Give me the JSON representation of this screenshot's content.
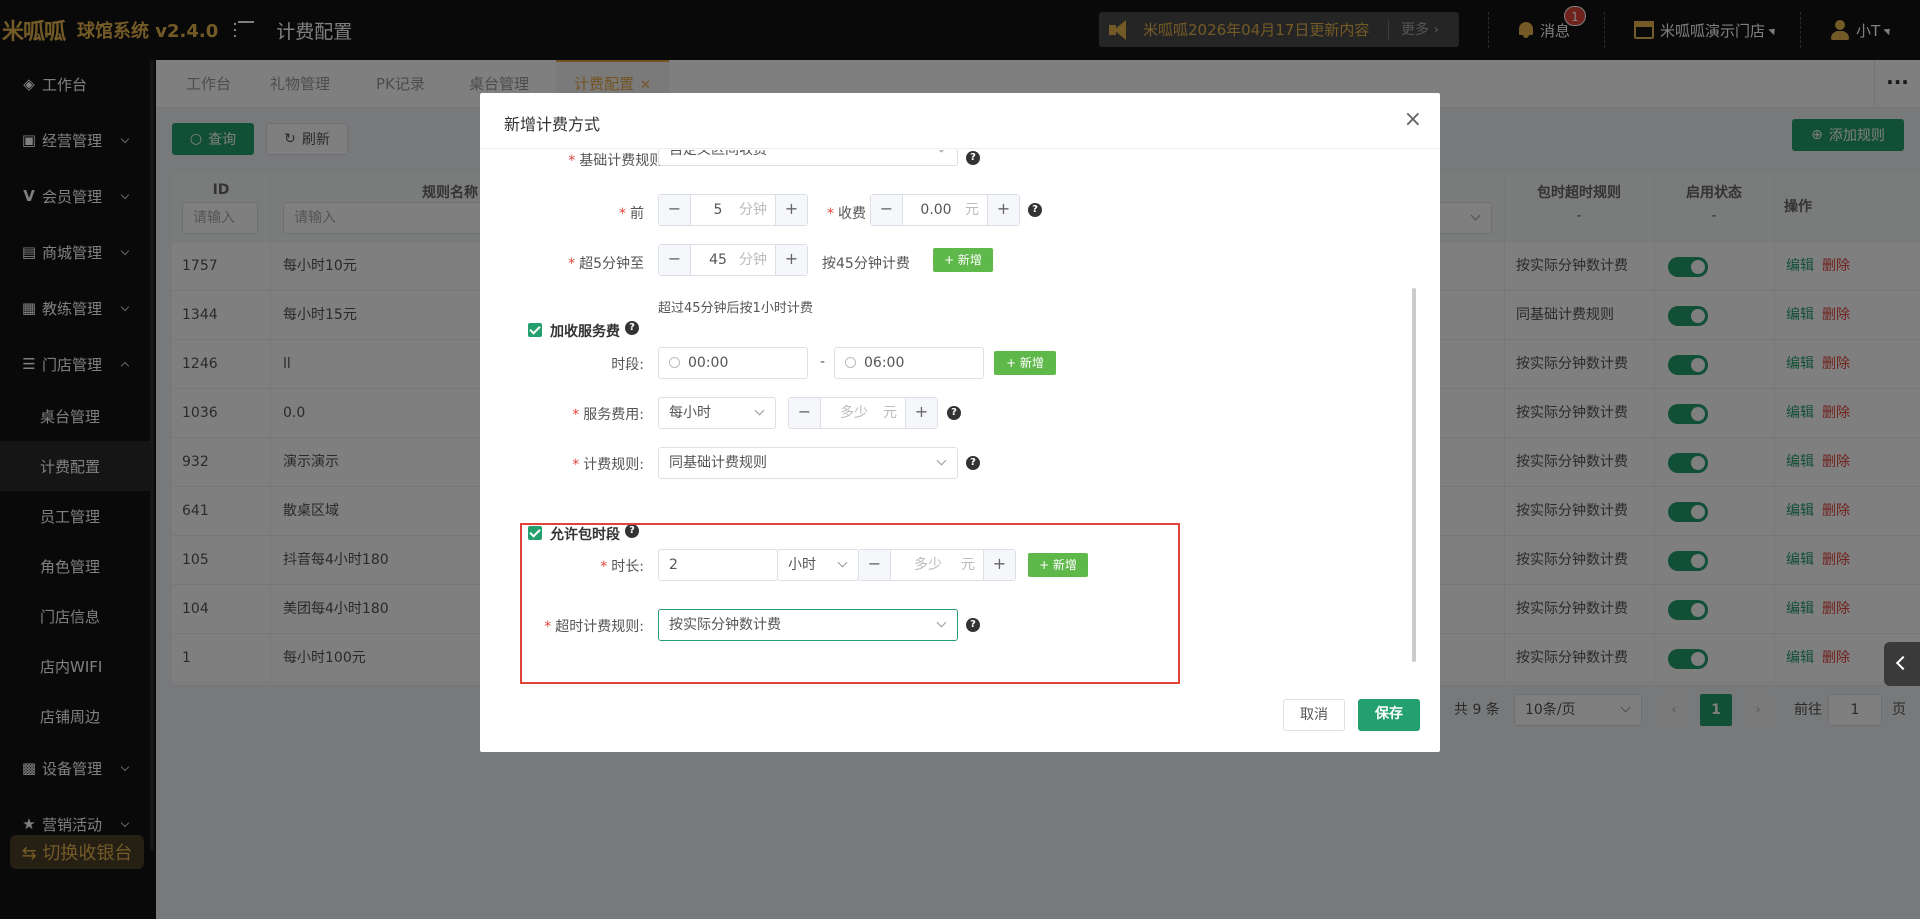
{
  "app": {
    "logo_text": "米呱呱",
    "title": "球馆系统 v2.4.0",
    "page_heading": "计费配置"
  },
  "header": {
    "notice_text": "米呱呱2026年04月17日更新内容",
    "notice_more": "更多 ›",
    "messages_label": "消息",
    "messages_badge": "1",
    "store_name": "米呱呱演示门店",
    "user_name": "小T"
  },
  "sidebar": {
    "items": [
      {
        "label": "工作台",
        "icon": "cube-icon"
      },
      {
        "label": "经营管理",
        "icon": "store-icon"
      },
      {
        "label": "会员管理",
        "icon": "vip-icon"
      },
      {
        "label": "商城管理",
        "icon": "bag-icon"
      },
      {
        "label": "教练管理",
        "icon": "coach-icon"
      },
      {
        "label": "门店管理",
        "icon": "database-icon"
      }
    ],
    "sub_items": [
      "桌台管理",
      "计费配置",
      "员工管理",
      "角色管理",
      "门店信息",
      "店内WIFI",
      "店铺周边"
    ],
    "bottom_items": [
      {
        "label": "设备管理",
        "icon": "device-icon"
      },
      {
        "label": "营销活动",
        "icon": "star-icon"
      }
    ],
    "switch_label": "⇆ 切换收银台"
  },
  "tabs": [
    "工作台",
    "礼物管理",
    "PK记录",
    "桌台管理",
    "计费配置"
  ],
  "toolbar": {
    "query": "查询",
    "refresh": "刷新",
    "add_rule": "添加规则"
  },
  "table": {
    "headers": {
      "id": "ID",
      "name": "规则名称",
      "overtime": "包时超时规则",
      "status": "启用状态",
      "ops": "操作",
      "dash": "-"
    },
    "filter_placeholder": "请输入",
    "rows": [
      {
        "id": "1757",
        "name": "每小时10元",
        "overtime": "按实际分钟数计费"
      },
      {
        "id": "1344",
        "name": "每小时15元",
        "overtime": "同基础计费规则"
      },
      {
        "id": "1246",
        "name": "ll",
        "overtime": "按实际分钟数计费"
      },
      {
        "id": "1036",
        "name": "0.0",
        "overtime": "按实际分钟数计费"
      },
      {
        "id": "932",
        "name": "演示演示",
        "overtime": "按实际分钟数计费"
      },
      {
        "id": "641",
        "name": "散桌区域",
        "overtime": "按实际分钟数计费"
      },
      {
        "id": "105",
        "name": "抖音每4小时180",
        "overtime": "按实际分钟数计费"
      },
      {
        "id": "104",
        "name": "美团每4小时180",
        "overtime": "按实际分钟数计费"
      },
      {
        "id": "1",
        "name": "每小时100元",
        "overtime": "按实际分钟数计费"
      }
    ],
    "edit": "编辑",
    "delete": "删除"
  },
  "pagination": {
    "total": "共 9 条",
    "page_size": "10条/页",
    "current": "1",
    "goto_prefix": "前往",
    "goto_value": "1",
    "goto_suffix": "页"
  },
  "modal": {
    "title": "新增计费方式",
    "base_rule_label": "基础计费规则:",
    "base_rule_value": "自定义区间收费",
    "front_label": "前",
    "front_value": "5",
    "minute_unit": "分钟",
    "charge_label": "收费",
    "charge_value": "0.00",
    "yuan_unit": "元",
    "over_label": "超5分钟至",
    "over_value": "45",
    "over_note": "按45分钟计费",
    "add_label": "+ 新增",
    "over_hint": "超过45分钟后按1小时计费",
    "service_check": "加收服务费",
    "period_label": "时段:",
    "time_start": "00:00",
    "time_end": "06:00",
    "service_fee_label": "服务费用:",
    "service_fee_unit": "每小时",
    "amount_placeholder": "多少",
    "billing_rule_label": "计费规则:",
    "billing_rule_value": "同基础计费规则",
    "package_check": "允许包时段",
    "duration_label": "时长:",
    "duration_value": "2",
    "hour_unit": "小时",
    "overtime_label": "超时计费规则:",
    "overtime_value": "按实际分钟数计费",
    "cancel": "取消",
    "save": "保存"
  },
  "colors": {
    "brand_gold": "#e7b54c",
    "primary_green": "#249f6e",
    "danger_red": "#e0443b"
  }
}
